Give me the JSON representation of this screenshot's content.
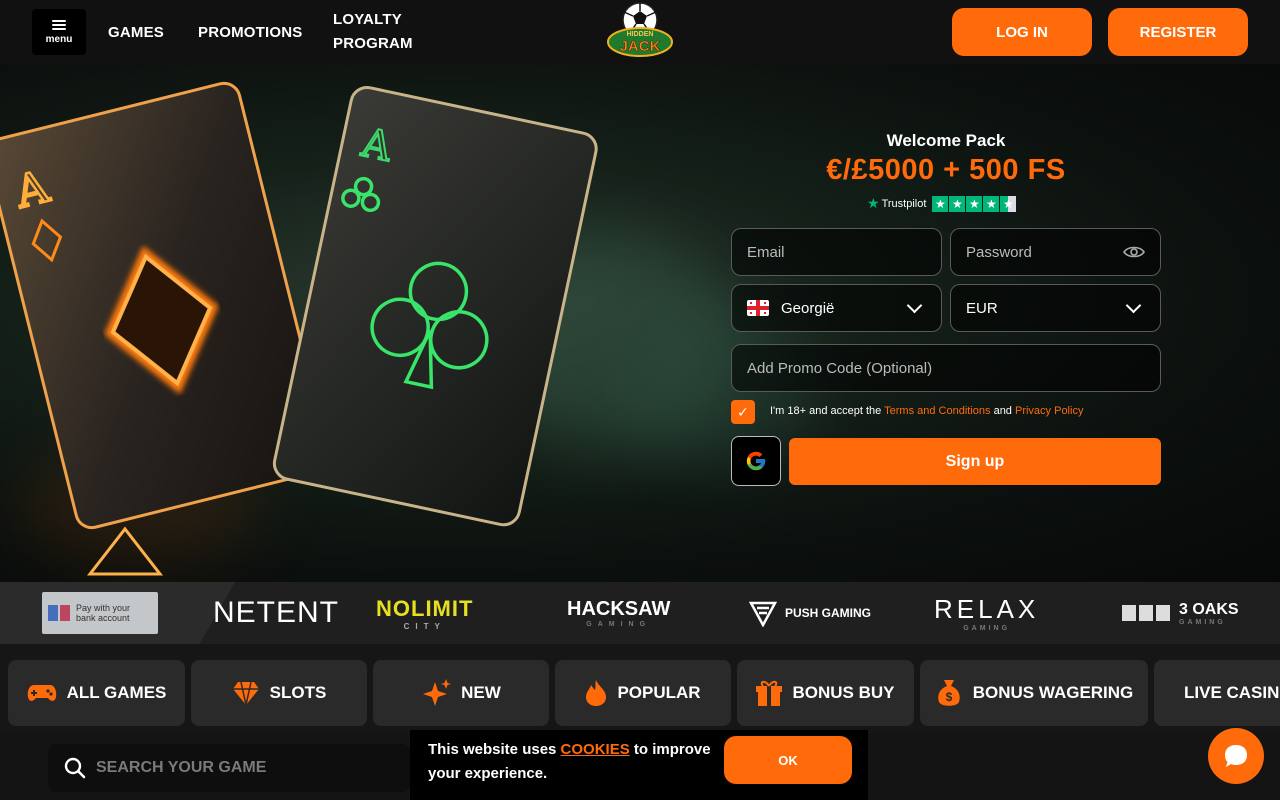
{
  "header": {
    "menu_label": "menu",
    "nav": [
      "GAMES",
      "PROMOTIONS",
      "LOYALTY PROGRAM"
    ],
    "logo_text": "HIDDEN JACK",
    "login_label": "LOG IN",
    "register_label": "REGISTER"
  },
  "hero": {
    "card_left_rank": "A",
    "card_right_rank": "A",
    "welcome_title": "Welcome Pack",
    "bonus_text": "€/£5000 + 500 FS",
    "trustpilot_label": "Trustpilot",
    "trustpilot_stars": 4.5
  },
  "form": {
    "email_placeholder": "Email",
    "password_placeholder": "Password",
    "country_value": "Georgië",
    "currency_value": "EUR",
    "promo_placeholder": "Add Promo Code (Optional)",
    "terms_prefix": "I'm 18+ and accept the ",
    "terms_link": "Terms and Conditions",
    "terms_and": " and ",
    "privacy_link": "Privacy Policy",
    "signup_label": "Sign up"
  },
  "providers": {
    "pay_badge": "Pay with your bank account",
    "items": [
      {
        "name": "NETENT",
        "sub": ""
      },
      {
        "name": "NOLIMIT",
        "sub": "CITY"
      },
      {
        "name": "HACKSAW",
        "sub": "GAMING"
      },
      {
        "name": "PUSH GAMING",
        "sub": ""
      },
      {
        "name": "RELAX",
        "sub": "GAMING"
      },
      {
        "name": "3 OAKS",
        "sub": "GAMING"
      }
    ]
  },
  "categories": [
    "ALL GAMES",
    "SLOTS",
    "NEW",
    "POPULAR",
    "BONUS BUY",
    "BONUS WAGERING",
    "LIVE CASINO"
  ],
  "search_placeholder": "SEARCH YOUR GAME",
  "cookie": {
    "text_before": "This website uses ",
    "link": "COOKIES",
    "text_after": " to improve your experience.",
    "ok_label": "OK"
  },
  "colors": {
    "accent": "#ff6b0a",
    "trustpilot": "#00b67a",
    "background": "#141414"
  }
}
